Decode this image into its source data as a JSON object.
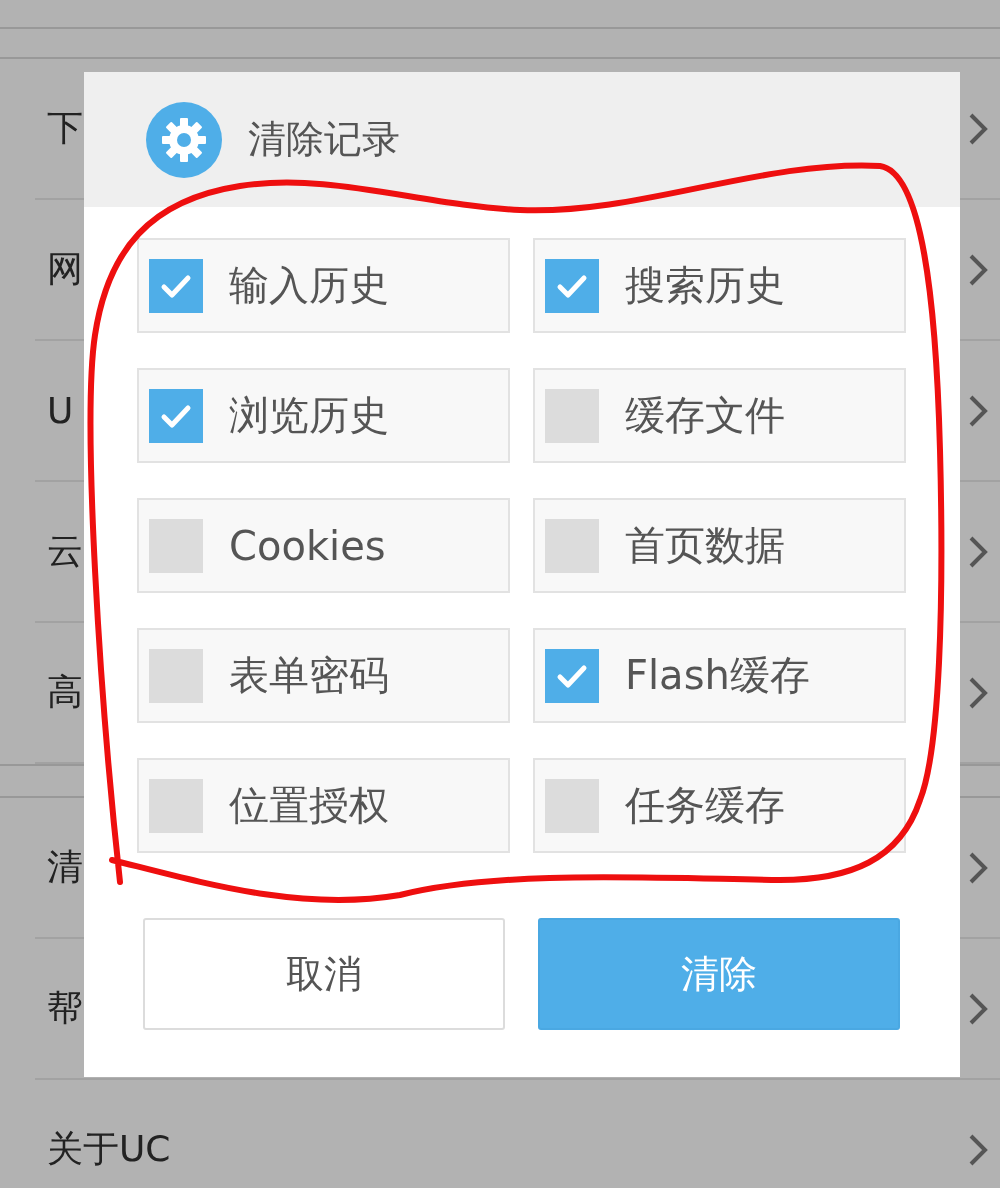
{
  "settings_list": {
    "groups": [
      {
        "items": [
          {
            "label": "下"
          },
          {
            "label": "网"
          },
          {
            "label": "U"
          },
          {
            "label": "云"
          },
          {
            "label": "高"
          }
        ]
      },
      {
        "items": [
          {
            "label": "清"
          },
          {
            "label": "帮"
          },
          {
            "label": "关于UC"
          }
        ]
      }
    ]
  },
  "dialog": {
    "title": "清除记录",
    "options": [
      {
        "label": "输入历史",
        "checked": true
      },
      {
        "label": "搜索历史",
        "checked": true
      },
      {
        "label": "浏览历史",
        "checked": true
      },
      {
        "label": "缓存文件",
        "checked": false
      },
      {
        "label": "Cookies",
        "checked": false
      },
      {
        "label": "首页数据",
        "checked": false
      },
      {
        "label": "表单密码",
        "checked": false
      },
      {
        "label": "Flash缓存",
        "checked": true
      },
      {
        "label": "位置授权",
        "checked": false
      },
      {
        "label": "任务缓存",
        "checked": false
      }
    ],
    "buttons": [
      {
        "label": "取消",
        "kind": "secondary"
      },
      {
        "label": "清除",
        "kind": "primary"
      }
    ]
  }
}
